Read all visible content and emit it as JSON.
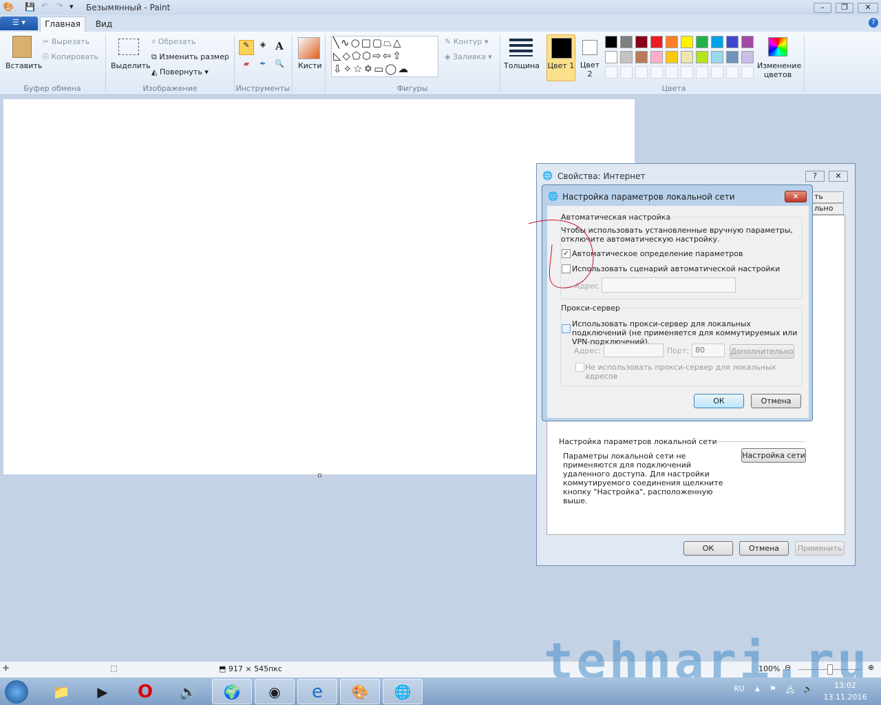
{
  "window": {
    "title": "Безымянный - Paint"
  },
  "tabs": [
    {
      "label": "Главная"
    },
    {
      "label": "Вид"
    }
  ],
  "ribbon": {
    "clipboard": {
      "paste": "Вставить",
      "cut": "Вырезать",
      "copy": "Копировать",
      "group": "Буфер обмена"
    },
    "image": {
      "select": "Выделить",
      "crop": "Обрезать",
      "resize": "Изменить размер",
      "rotate": "Повернуть",
      "group": "Изображение"
    },
    "tools": {
      "group": "Инструменты"
    },
    "brushes": {
      "label": "Кисти"
    },
    "shapes": {
      "outline": "Контур",
      "fill": "Заливка",
      "group": "Фигуры"
    },
    "size": {
      "label": "Толщина"
    },
    "color1": {
      "label": "Цвет 1"
    },
    "color2": {
      "label": "Цвет 2"
    },
    "edit_colors": {
      "label": "Изменение цветов"
    },
    "colors": {
      "group": "Цвета",
      "palette": [
        "#000000",
        "#7f7f7f",
        "#880015",
        "#ed1c24",
        "#ff7f27",
        "#fff200",
        "#22b14c",
        "#00a2e8",
        "#3f48cc",
        "#a349a4",
        "#ffffff",
        "#c3c3c3",
        "#b97a57",
        "#ffaec9",
        "#ffc90e",
        "#efe4b0",
        "#b5e61d",
        "#99d9ea",
        "#7092be",
        "#c8bfe7"
      ]
    }
  },
  "status": {
    "size": "917 × 545пкс",
    "zoom": "100%"
  },
  "inet_dialog": {
    "title": "Свойства: Интернет",
    "help": "?",
    "tab_partial_1": "ть",
    "tab_partial_2": "льно",
    "lan_label": "Настройка параметров локальной сети",
    "lan_text": "Параметры локальной сети не применяются для подключений удаленного доступа. Для настройки коммутируемого соединения щелкните кнопку \"Настройка\", расположенную выше.",
    "lan_button": "Настройка сети",
    "ok": "ОК",
    "cancel": "Отмена",
    "apply": "Применить"
  },
  "lan_dialog": {
    "title": "Настройка параметров локальной сети",
    "auto_group": "Автоматическая настройка",
    "auto_desc": "Чтобы использовать установленные вручную параметры, отключите автоматическую настройку.",
    "auto_detect": "Автоматическое определение параметров",
    "auto_detect_checked": true,
    "auto_script": "Использовать сценарий автоматической настройки",
    "auto_script_checked": false,
    "address_label": "Адрес",
    "address_value": "",
    "proxy_group": "Прокси-сервер",
    "use_proxy": "Использовать прокси-сервер для локальных подключений (не применяется для коммутируемых или VPN-подключений).",
    "use_proxy_checked": false,
    "proxy_address_label": "Адрес:",
    "proxy_address_value": "",
    "port_label": "Порт:",
    "port_value": "80",
    "advanced": "Дополнительно",
    "bypass_local": "Не использовать прокси-сервер для локальных адресов",
    "bypass_checked": false,
    "ok": "ОК",
    "cancel": "Отмена"
  },
  "watermark": "tehnari.ru",
  "tray": {
    "lang": "RU",
    "time": "13:02",
    "date": "13.11.2016"
  }
}
